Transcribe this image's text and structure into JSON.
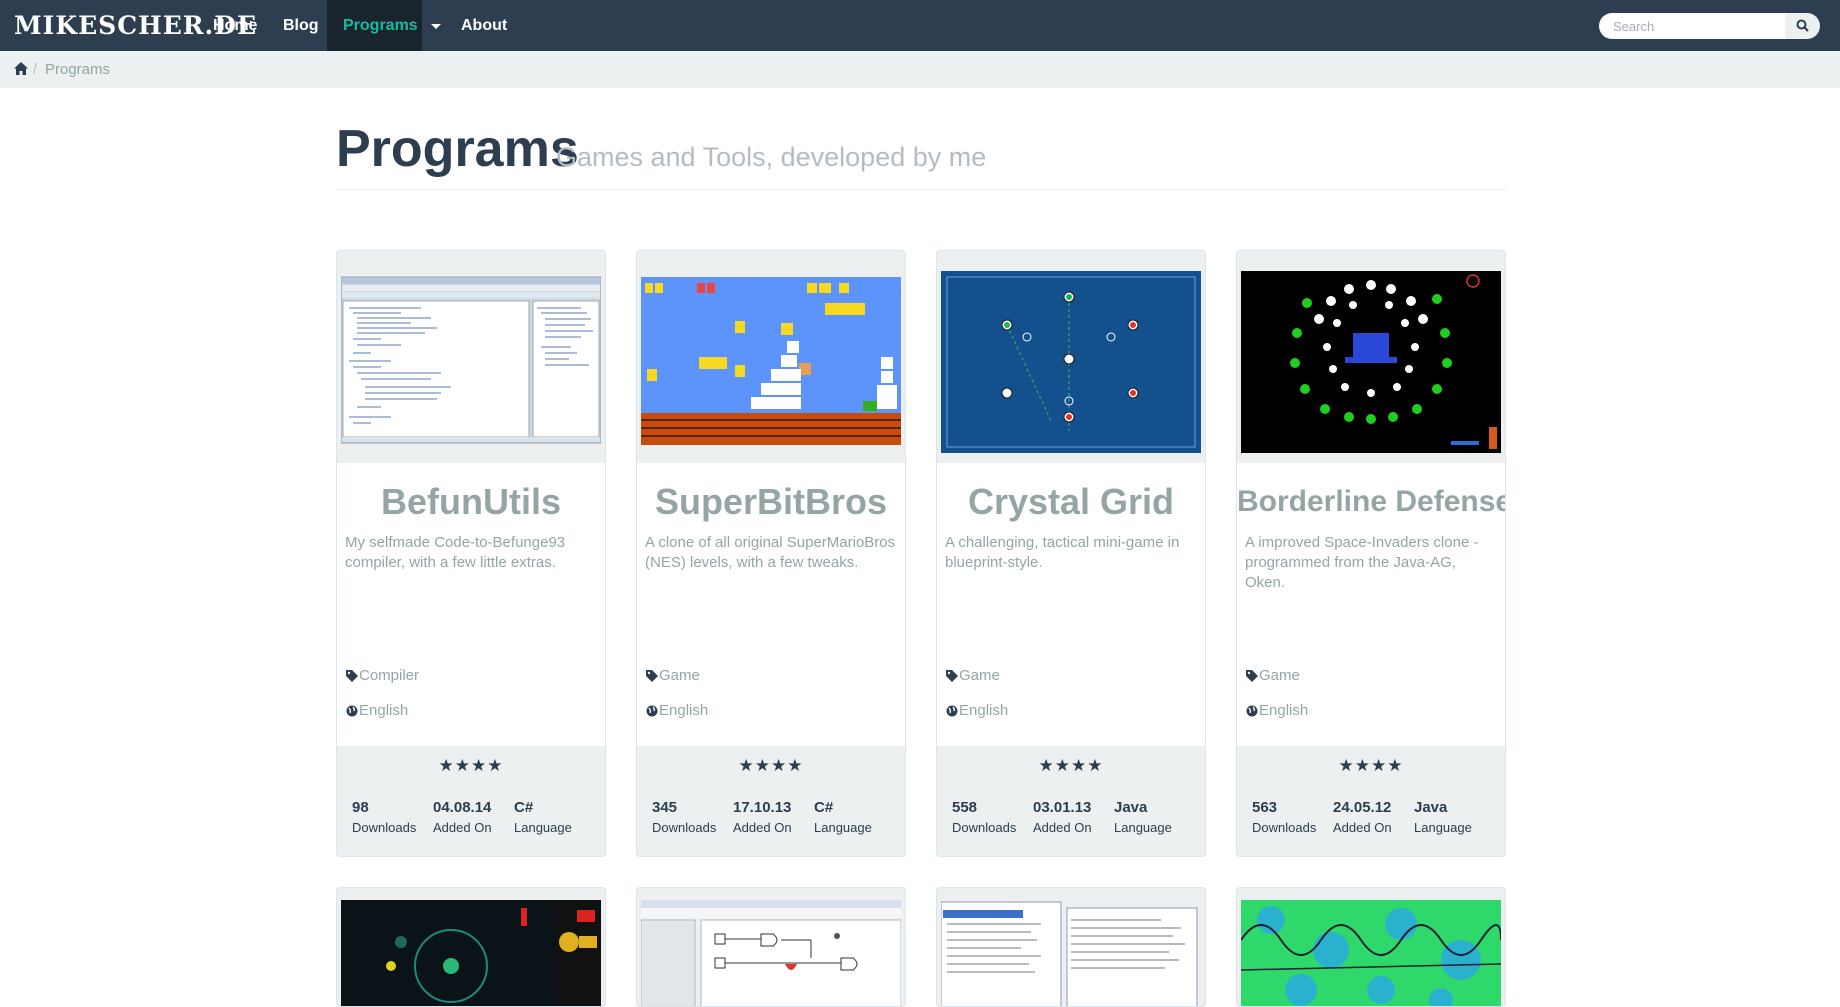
{
  "navbar": {
    "brand": "MIKESCHER.DE",
    "items": [
      {
        "label": "Home"
      },
      {
        "label": "Blog"
      },
      {
        "label": "Programs"
      },
      {
        "label": "About"
      }
    ],
    "search": {
      "placeholder": "Search"
    }
  },
  "breadcrumb": {
    "separator": "/",
    "current": "Programs"
  },
  "header": {
    "title": "Programs",
    "subtitle": "Games and Tools, developed by me"
  },
  "colors": {
    "navbar": "#2c3e50",
    "accent": "#18bc9c",
    "muted": "#95a5a6",
    "panel": "#ecf0f1"
  },
  "cards": [
    {
      "title": "BefunUtils",
      "description": "My selfmade Code-to-Befunge93 compiler, with a few little extras.",
      "category": "Compiler",
      "language_label": "English",
      "rating": "★★★★",
      "downloads": "98",
      "downloads_label": "Downloads",
      "added": "04.08.14",
      "added_label": "Added On",
      "lang": "C#",
      "lang_label": "Language",
      "icon": "tag-icon"
    },
    {
      "title": "SuperBitBros",
      "description": "A clone of all original SuperMarioBros (NES) levels, with a few tweaks.",
      "category": "Game",
      "language_label": "English",
      "rating": "★★★★",
      "downloads": "345",
      "downloads_label": "Downloads",
      "added": "17.10.13",
      "added_label": "Added On",
      "lang": "C#",
      "lang_label": "Language",
      "icon": "tag-icon"
    },
    {
      "title": "Crystal Grid",
      "description": "A challenging, tactical mini-game in blueprint-style.",
      "category": "Game",
      "language_label": "English",
      "rating": "★★★★",
      "downloads": "558",
      "downloads_label": "Downloads",
      "added": "03.01.13",
      "added_label": "Added On",
      "lang": "Java",
      "lang_label": "Language",
      "icon": "tag-icon"
    },
    {
      "title": "Borderline Defense",
      "description": "A improved Space-Invaders clone - programmed from the Java-AG, Oken.",
      "category": "Game",
      "language_label": "English",
      "rating": "★★★★",
      "downloads": "563",
      "downloads_label": "Downloads",
      "added": "24.05.12",
      "added_label": "Added On",
      "lang": "Java",
      "lang_label": "Language",
      "icon": "tag-icon"
    }
  ]
}
